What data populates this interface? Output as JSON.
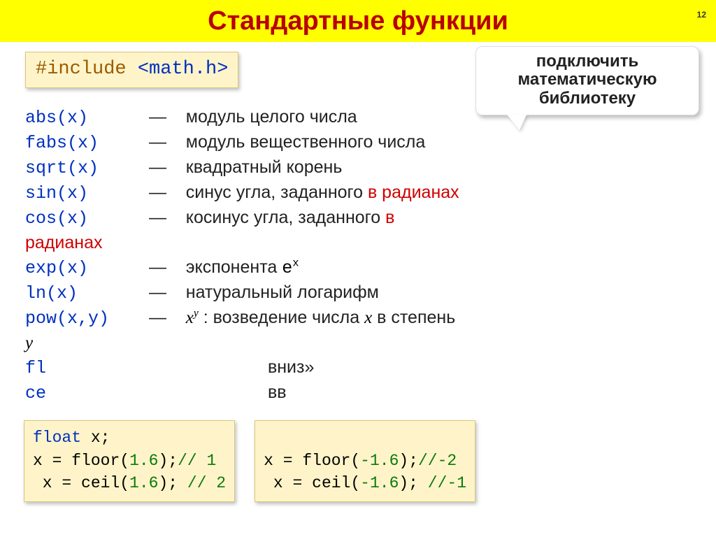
{
  "page_number": "12",
  "title": "Стандартные функции",
  "include": {
    "directive": "#include",
    "header": "<math.h>"
  },
  "callout": {
    "l1": "подключить",
    "l2": "математическую",
    "l3": "библиотеку"
  },
  "funcs": {
    "abs": {
      "sig": "abs(x)",
      "desc": "модуль целого числа"
    },
    "fabs": {
      "sig": "fabs(x)",
      "desc": "модуль вещественного числа"
    },
    "sqrt": {
      "sig": "sqrt(x)",
      "desc": "квадратный корень"
    },
    "sin": {
      "sig": "sin(x)",
      "desc_a": "синус угла, заданного ",
      "desc_b": "в радианах"
    },
    "cos": {
      "sig": "cos(x)",
      "desc_a": "косинус угла, заданного ",
      "desc_b": "в",
      "desc_c": "радианах"
    },
    "exp": {
      "sig": "exp(x)",
      "desc_a": "экспонента ",
      "base": "е",
      "sup": "x"
    },
    "ln": {
      "sig": "ln(x)",
      "desc": "натуральный логарифм"
    },
    "pow": {
      "sig": "pow(x,y)",
      "desc_a": ": возведение числа ",
      "desc_b": " в степень",
      "var_x": "x",
      "var_y": "y",
      "sup_y": "y"
    },
    "floor": {
      "sig": "fl",
      "tail": "вниз»"
    },
    "ceil": {
      "sig": "ce",
      "tail": "вв"
    }
  },
  "dash": "—",
  "snippet_left": {
    "l1_type": "float",
    "l1_rest": " x;",
    "l2a": "x",
    "l2b": " = ",
    "l2c": "floor(",
    "l2n": "1.6",
    "l2d": ");",
    "l2cmt": "// 1",
    "l3a": " x",
    "l3b": " = ",
    "l3c": "ceil(",
    "l3n": "1.6",
    "l3d": "); ",
    "l3cmt": "// 2"
  },
  "snippet_right": {
    "l2a": "x",
    "l2b": " = ",
    "l2c": "floor(",
    "l2n": "-1.6",
    "l2d": ");",
    "l2cmt": "//-2",
    "l3a": " x",
    "l3b": " = ",
    "l3c": "ceil(",
    "l3n": "-1.6",
    "l3d": "); ",
    "l3cmt": "//-1"
  }
}
